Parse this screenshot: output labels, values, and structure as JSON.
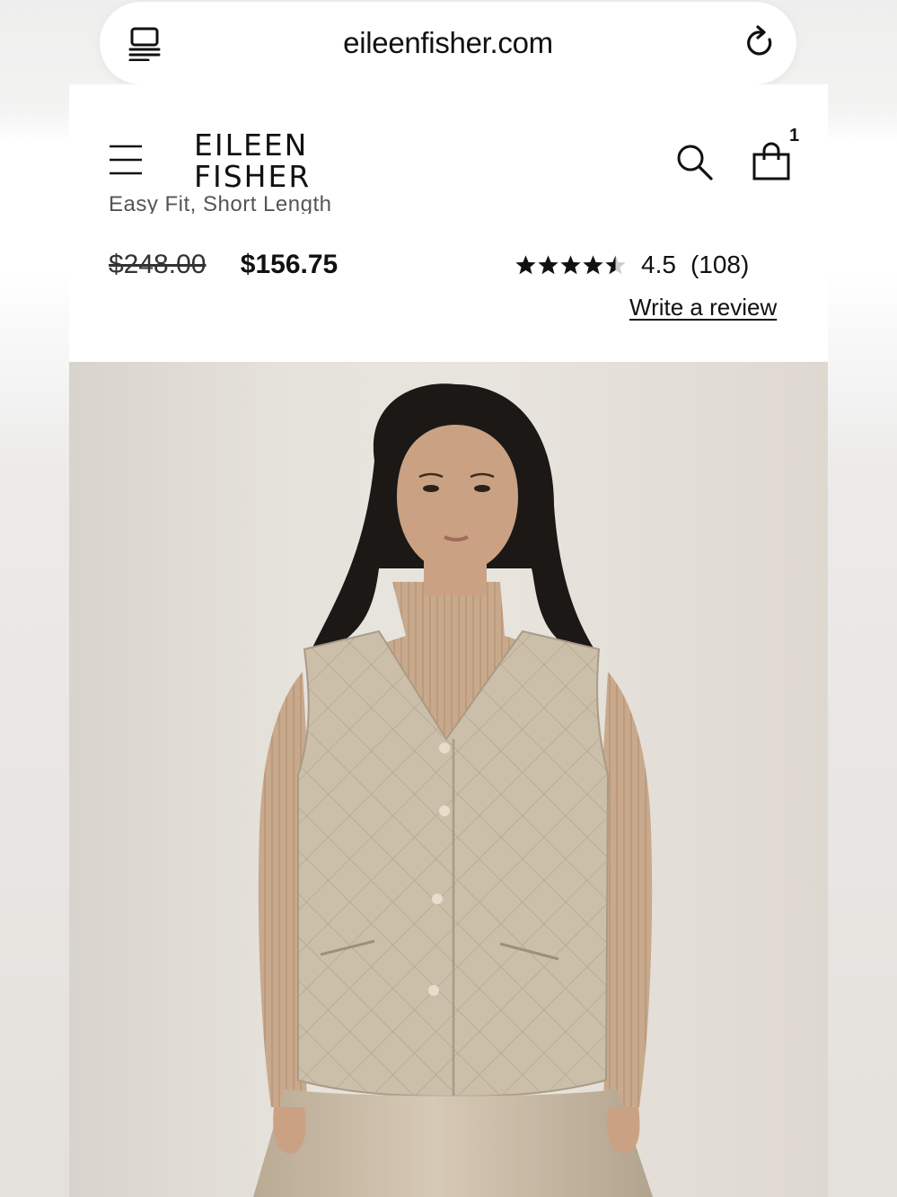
{
  "browser": {
    "url": "eileenfisher.com",
    "reader_icon": "reader-mode-icon",
    "reload_icon": "reload-icon"
  },
  "header": {
    "logo_line1": "EILEEN",
    "logo_line2": "FISHER",
    "menu_icon": "hamburger-menu-icon",
    "search_icon": "search-icon",
    "cart_icon": "shopping-bag-icon",
    "cart_count": "1"
  },
  "product": {
    "subtitle": "Easy Fit, Short Length",
    "original_price": "$248.00",
    "sale_price": "$156.75",
    "rating": {
      "value": 4.5,
      "value_label": "4.5",
      "count_label": "(108)",
      "max_stars": 5
    },
    "write_review_label": "Write a review"
  },
  "colors": {
    "text": "#111111",
    "star": "#111111",
    "star_empty": "#cccccc",
    "image_background": "#e6e2dc",
    "vest": "#cbbfa9",
    "sweater": "#c9a98c",
    "skirt": "#cfc1ac",
    "hair": "#1c1816",
    "skin": "#caa283"
  }
}
